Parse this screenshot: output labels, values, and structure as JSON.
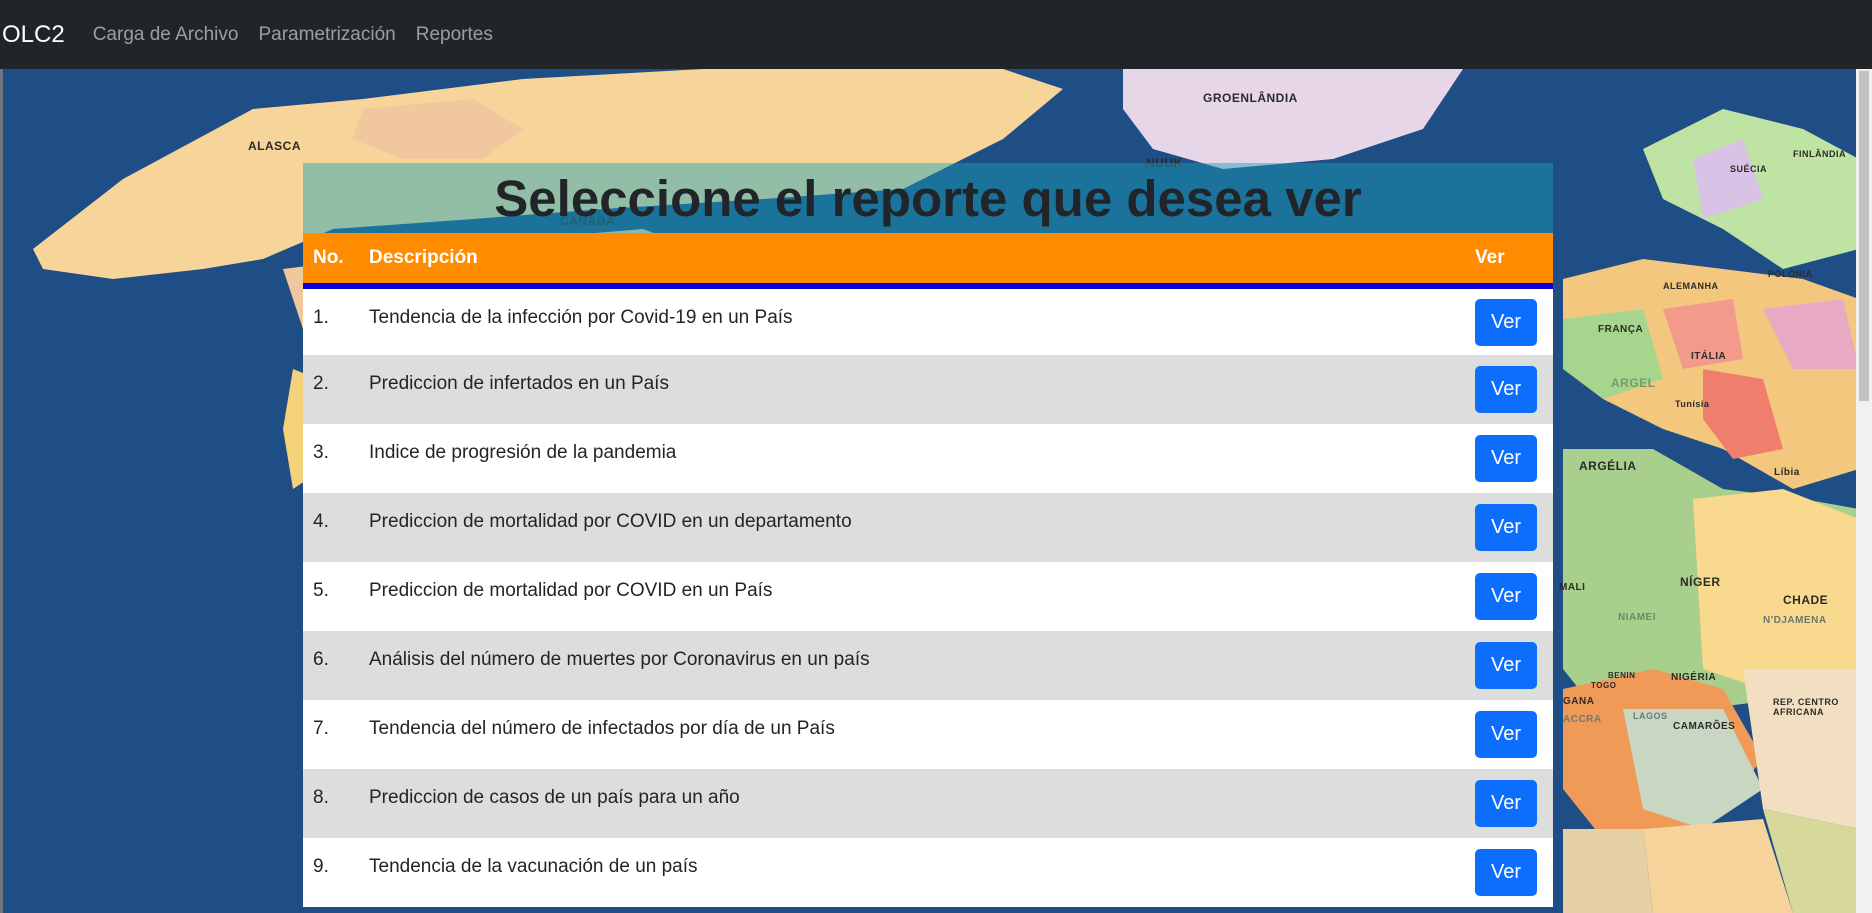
{
  "navbar": {
    "brand": "OLC2",
    "links": [
      "Carga de Archivo",
      "Parametrización",
      "Reportes"
    ]
  },
  "map_labels": [
    "ALASCA",
    "GROENLÂNDIA",
    "NUUK",
    "CANADÁ",
    "FINLÂNDIA",
    "SUÉCIA",
    "POLÔNIA",
    "ALEMANHA",
    "FRANÇA",
    "ITÁLIA",
    "ARGEL",
    "Tunísia",
    "ARGÉLIA",
    "Líbia",
    "NÍGER",
    "CHADE",
    "MALI",
    "NIAMEI",
    "N'DJAMENA",
    "NIGÉRIA",
    "GANA",
    "ACCRA",
    "LAGOS",
    "CAMARÕES",
    "BENIN",
    "TOGO",
    "REP. CENTRO AFRICANA"
  ],
  "panel": {
    "title": "Seleccione el reporte que desea ver",
    "headers": {
      "no": "No.",
      "description": "Descripción",
      "action": "Ver"
    },
    "button_label": "Ver",
    "rows": [
      {
        "no": "1.",
        "description": "Tendencia de la infección por Covid-19 en un País"
      },
      {
        "no": "2.",
        "description": "Prediccion de infertados en un País"
      },
      {
        "no": "3.",
        "description": "Indice de progresión de la pandemia"
      },
      {
        "no": "4.",
        "description": "Prediccion de mortalidad por COVID en un departamento"
      },
      {
        "no": "5.",
        "description": "Prediccion de mortalidad por COVID en un País"
      },
      {
        "no": "6.",
        "description": "Análisis del número de muertes por Coronavirus en un país"
      },
      {
        "no": "7.",
        "description": "Tendencia del número de infectados por día de un País"
      },
      {
        "no": "8.",
        "description": "Prediccion de casos de un país para un año"
      },
      {
        "no": "9.",
        "description": "Tendencia de la vacunación de un país"
      }
    ]
  },
  "colors": {
    "navbar": "#212529",
    "ocean": "#1f4e86",
    "title_bar": "#17a2b8",
    "table_header": "#ff8c00",
    "header_border": "#0d00d6",
    "button": "#0d6efd"
  }
}
